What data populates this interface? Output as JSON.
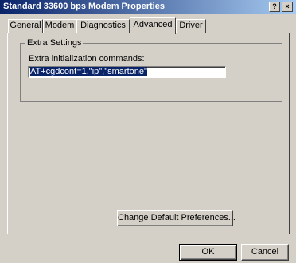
{
  "window": {
    "title": "Standard 33600 bps Modem Properties",
    "help_label": "?",
    "close_label": "×"
  },
  "tabs": [
    {
      "label": "General"
    },
    {
      "label": "Modem"
    },
    {
      "label": "Diagnostics"
    },
    {
      "label": "Advanced"
    },
    {
      "label": "Driver"
    }
  ],
  "extra_settings": {
    "group_title": "Extra Settings",
    "init_label": "Extra initialization commands:",
    "init_value": "AT+cgdcont=1,\"ip\",\"smartone\""
  },
  "buttons": {
    "change_defaults": "Change Default Preferences...",
    "ok": "OK",
    "cancel": "Cancel"
  },
  "colors": {
    "titlebar": "#0a246a",
    "face": "#d4d0c8"
  }
}
